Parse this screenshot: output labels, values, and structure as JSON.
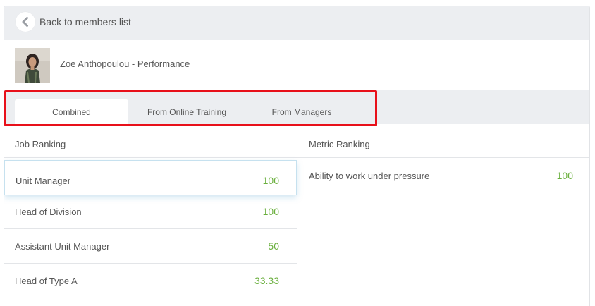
{
  "back": {
    "label": "Back to members list",
    "icon": "chevron-left-icon"
  },
  "member": {
    "name": "Zoe Anthopoulou - Performance"
  },
  "tabs": [
    {
      "label": "Combined",
      "active": true
    },
    {
      "label": "From Online Training",
      "active": false
    },
    {
      "label": "From Managers",
      "active": false
    }
  ],
  "job_ranking": {
    "title": "Job Ranking",
    "rows": [
      {
        "name": "Unit Manager",
        "score": "100"
      },
      {
        "name": "Head of Division",
        "score": "100"
      },
      {
        "name": "Assistant Unit Manager",
        "score": "50"
      },
      {
        "name": "Head of Type A",
        "score": "33.33"
      }
    ]
  },
  "metric_ranking": {
    "title": "Metric Ranking",
    "rows": [
      {
        "name": "Ability to work under pressure",
        "score": "100"
      }
    ]
  },
  "colors": {
    "score": "#6aaf3d",
    "highlight": "#e8101a",
    "bar_bg": "#eceef1"
  }
}
